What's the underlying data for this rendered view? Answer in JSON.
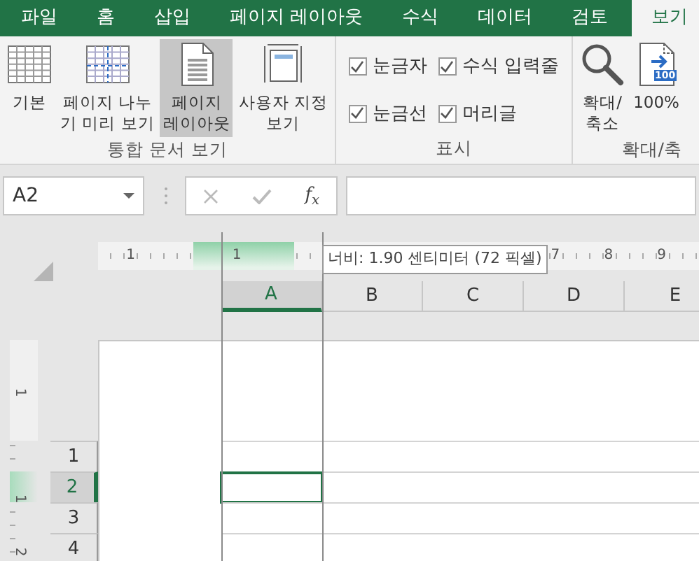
{
  "ribbon_tabs": [
    {
      "label": "파일",
      "selected": false
    },
    {
      "label": "홈",
      "selected": false
    },
    {
      "label": "삽입",
      "selected": false
    },
    {
      "label": "페이지 레이아웃",
      "selected": false
    },
    {
      "label": "수식",
      "selected": false
    },
    {
      "label": "데이터",
      "selected": false
    },
    {
      "label": "검토",
      "selected": false
    },
    {
      "label": "보기",
      "selected": true
    }
  ],
  "ribbon_groups": [
    {
      "kind": "buttons",
      "label": "통합 문서 보기",
      "buttons": [
        {
          "kind": "normal",
          "lines": [
            "기본"
          ],
          "selected": false
        },
        {
          "kind": "pagebreak",
          "lines": [
            "페이지 나누",
            "기 미리 보기"
          ],
          "selected": false
        },
        {
          "kind": "pagelayout",
          "lines": [
            "페이지",
            "레이아웃"
          ],
          "selected": true
        },
        {
          "kind": "custom",
          "lines": [
            "사용자 지정",
            "보기"
          ],
          "selected": false
        }
      ]
    },
    {
      "kind": "checks",
      "label": "표시",
      "checks": [
        {
          "label": "눈금자",
          "checked": true
        },
        {
          "label": "수식 입력줄",
          "checked": true
        },
        {
          "label": "눈금선",
          "checked": true
        },
        {
          "label": "머리글",
          "checked": true
        }
      ]
    },
    {
      "kind": "buttons",
      "label": "확대/축",
      "buttons": [
        {
          "kind": "zoom",
          "lines": [
            "확대/",
            "축소"
          ],
          "selected": false
        },
        {
          "kind": "hundred",
          "lines": [
            "100%"
          ],
          "badge": "100",
          "selected": false
        }
      ]
    }
  ],
  "formula_bar": {
    "name_box": "A2",
    "function_button": "f$_{x}$"
  },
  "horizontal_ruler": [
    "1",
    "1",
    "7",
    "8",
    "9"
  ],
  "vertical_ruler": [
    "1",
    "1",
    "2"
  ],
  "tooltip": "너비: 1.90 센티미터 (72 픽셀)",
  "columns": [
    {
      "label": "A",
      "selected": true
    },
    {
      "label": "B",
      "selected": false
    },
    {
      "label": "C",
      "selected": false
    },
    {
      "label": "D",
      "selected": false
    },
    {
      "label": "E",
      "selected": false
    }
  ],
  "rows": [
    {
      "label": "1",
      "selected": false
    },
    {
      "label": "2",
      "selected": true
    },
    {
      "label": "3",
      "selected": false
    },
    {
      "label": "4",
      "selected": false
    }
  ]
}
